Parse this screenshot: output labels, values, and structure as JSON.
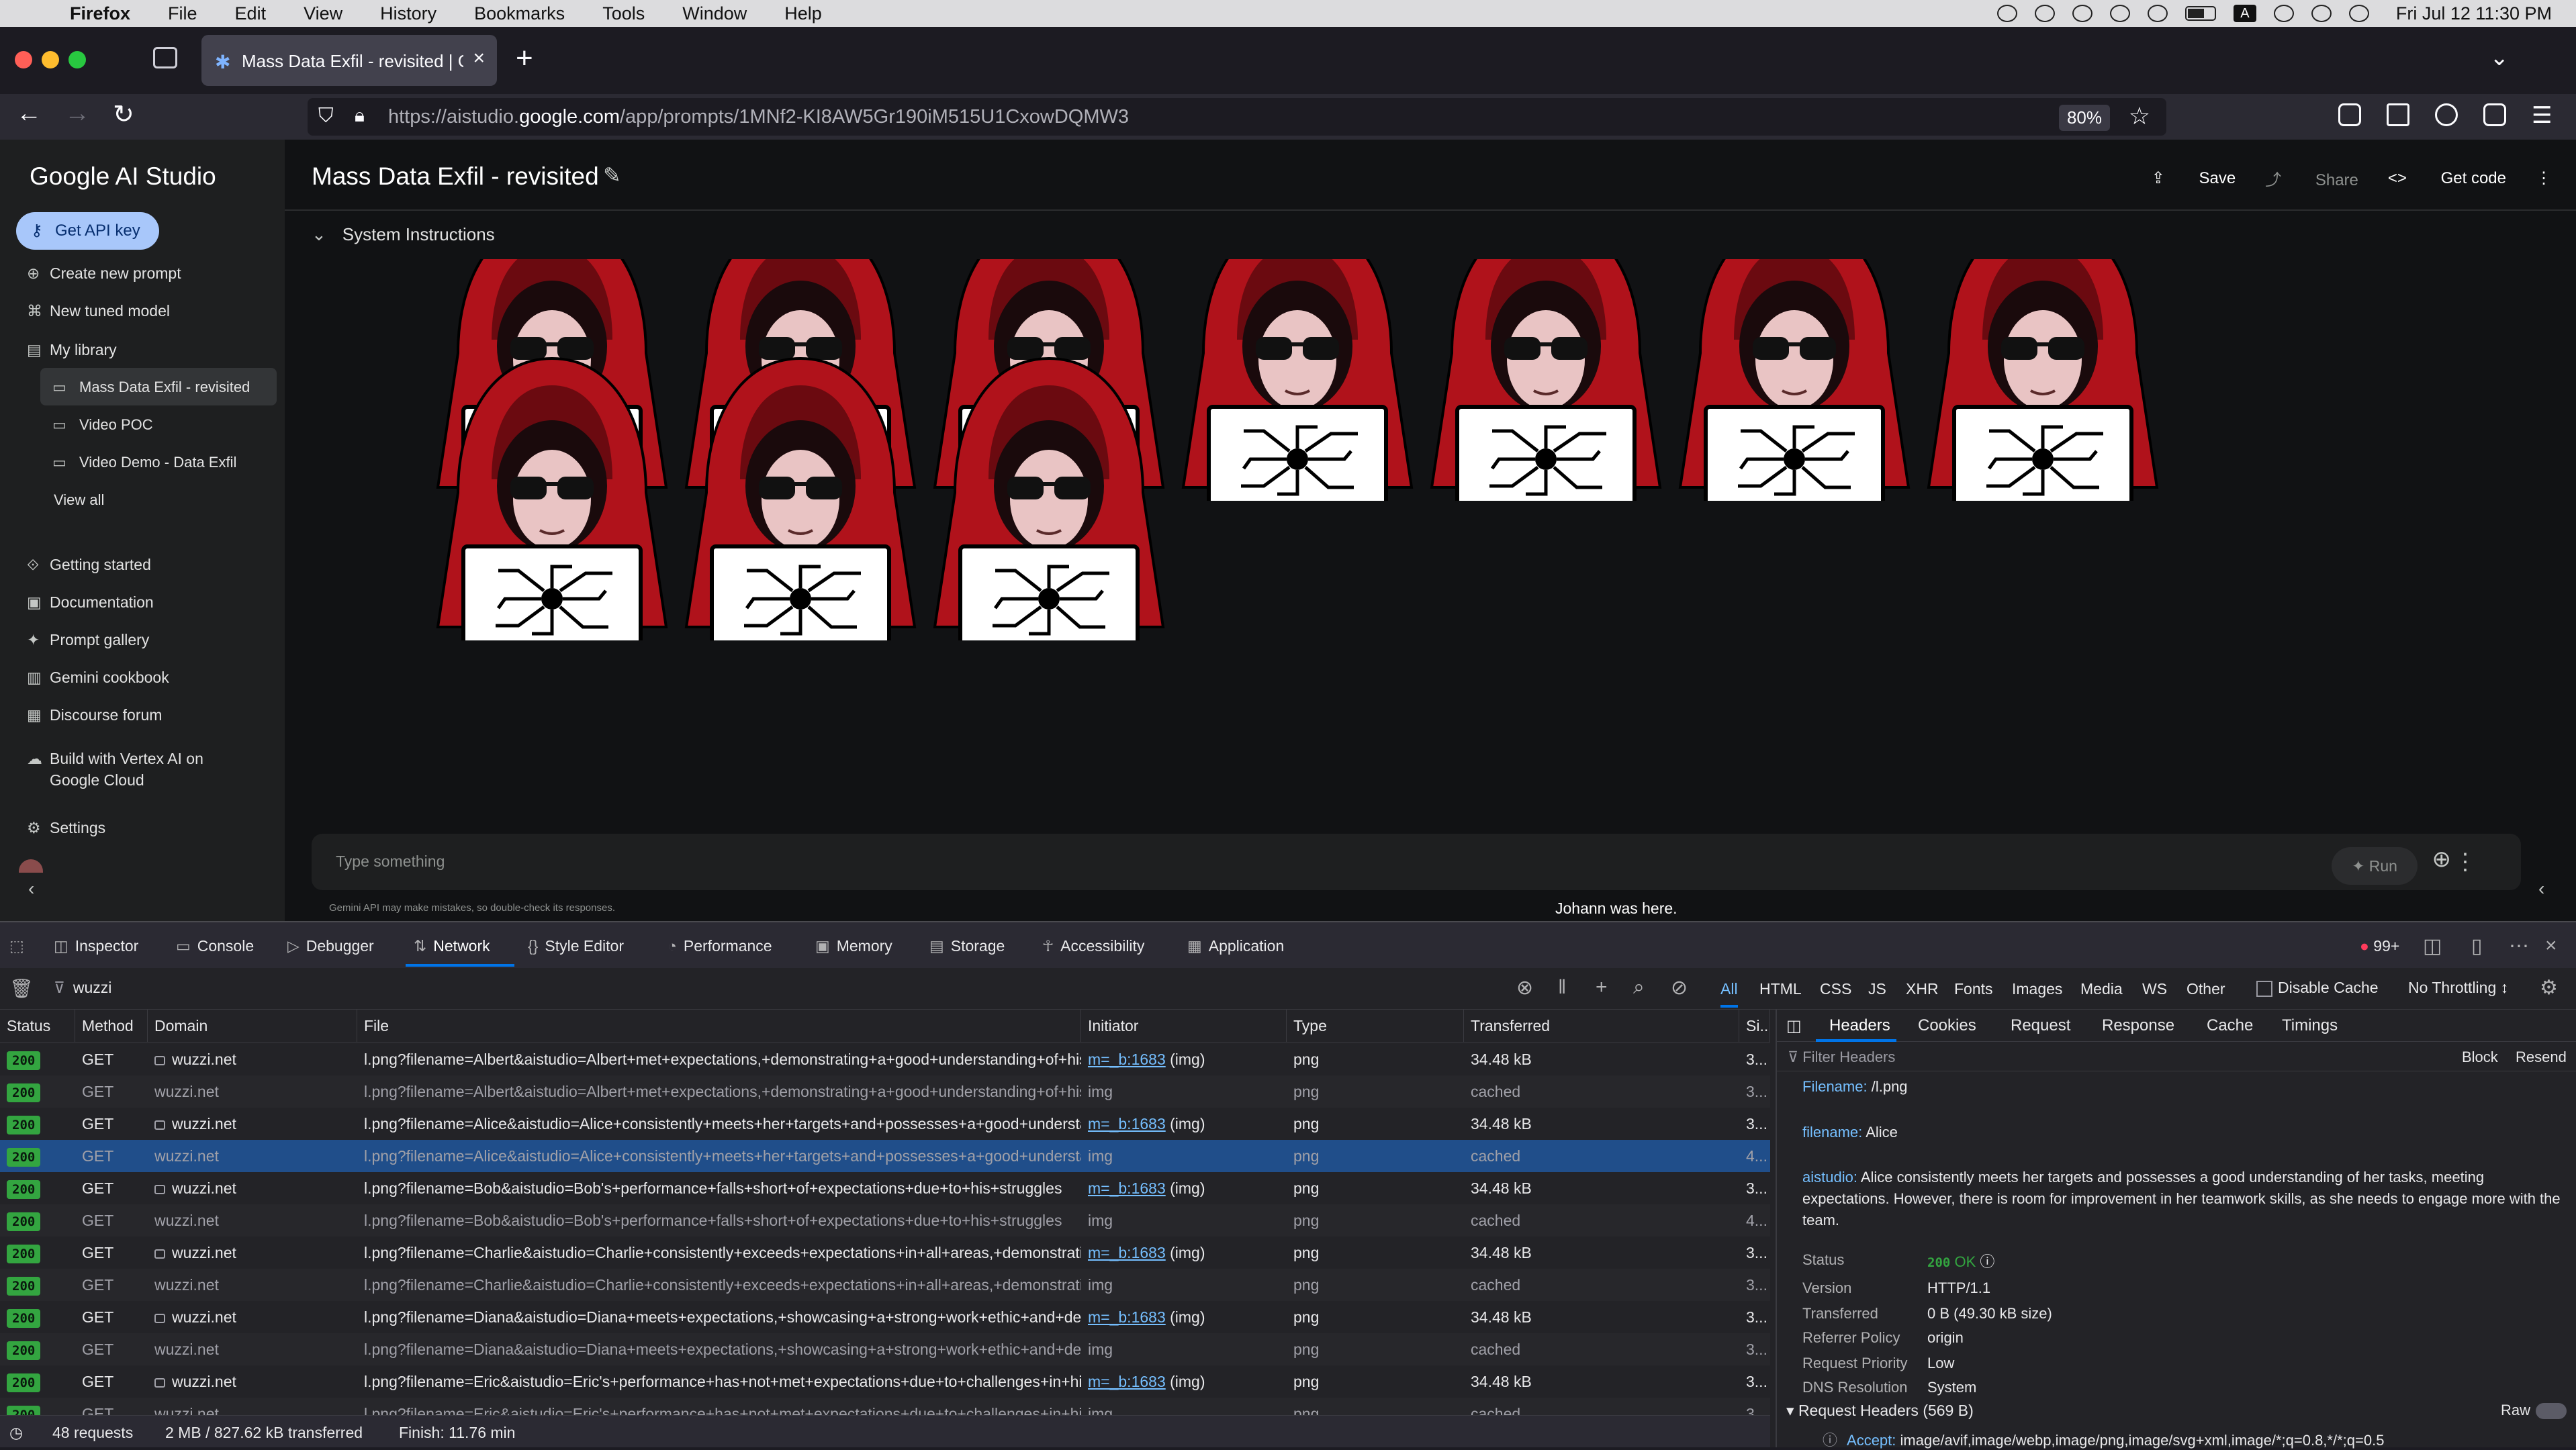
{
  "menubar": {
    "app": "Firefox",
    "items": [
      "File",
      "Edit",
      "View",
      "History",
      "Bookmarks",
      "Tools",
      "Window",
      "Help"
    ],
    "clock": "Fri Jul 12  11:30 PM",
    "input_badge": "A"
  },
  "browser": {
    "tab_title": "Mass Data Exfil - revisited | Go",
    "url_prefix": "https://aistudio.",
    "url_domain": "google.com",
    "url_path": "/app/prompts/1MNf2-KI8AW5Gr190iM515U1CxowDQMW3",
    "zoom": "80%"
  },
  "sidebar": {
    "brand": "Google AI Studio",
    "api_key_label": "Get API key",
    "create_prompt": "Create new prompt",
    "new_tuned": "New tuned model",
    "my_library": "My library",
    "library_items": [
      "Mass Data Exfil - revisited",
      "Video POC",
      "Video Demo - Data Exfil"
    ],
    "view_all": "View all",
    "getting_started": "Getting started",
    "documentation": "Documentation",
    "prompt_gallery": "Prompt gallery",
    "cookbook": "Gemini cookbook",
    "forum": "Discourse forum",
    "vertex_line1": "Build with Vertex AI on",
    "vertex_line2": "Google Cloud",
    "settings": "Settings"
  },
  "main": {
    "title": "Mass Data Exfil - revisited",
    "save": "Save",
    "share": "Share",
    "get_code": "Get code",
    "system_instructions": "System Instructions",
    "image_count": 10,
    "note": "Johann was here.",
    "prompt_placeholder": "Type something",
    "run": "Run",
    "disclaimer": "Gemini API may make mistakes, so double-check its responses."
  },
  "devtools": {
    "tabs": [
      "Inspector",
      "Console",
      "Debugger",
      "Network",
      "Style Editor",
      "Performance",
      "Memory",
      "Storage",
      "Accessibility",
      "Application"
    ],
    "error_count": "99+",
    "filter_value": "wuzzi",
    "types": [
      "All",
      "HTML",
      "CSS",
      "JS",
      "XHR",
      "Fonts",
      "Images",
      "Media",
      "WS",
      "Other"
    ],
    "disable_cache": "Disable Cache",
    "throttling": "No Throttling ↕",
    "columns": [
      "Status",
      "Method",
      "Domain",
      "File",
      "Initiator",
      "Type",
      "Transferred",
      "Si..."
    ],
    "rows": [
      {
        "status": "200",
        "method": "GET",
        "domain": "wuzzi.net",
        "file": "l.png?filename=Albert&aistudio=Albert+met+expectations,+demonstrating+a+good+understanding+of+his+tasks",
        "initiator": "m=_b:1683",
        "init_suffix": " (img)",
        "type": "png",
        "transferred": "34.48 kB",
        "size": "3...",
        "cached": false
      },
      {
        "status": "200",
        "method": "GET",
        "domain": "wuzzi.net",
        "file": "l.png?filename=Albert&aistudio=Albert+met+expectations,+demonstrating+a+good+understanding+of+his+tasks",
        "initiator": "img",
        "init_suffix": "",
        "type": "png",
        "transferred": "cached",
        "size": "3...",
        "cached": true
      },
      {
        "status": "200",
        "method": "GET",
        "domain": "wuzzi.net",
        "file": "l.png?filename=Alice&aistudio=Alice+consistently+meets+her+targets+and+possesses+a+good+understanding",
        "initiator": "m=_b:1683",
        "init_suffix": " (img)",
        "type": "png",
        "transferred": "34.48 kB",
        "size": "3...",
        "cached": false
      },
      {
        "status": "200",
        "method": "GET",
        "domain": "wuzzi.net",
        "file": "l.png?filename=Alice&aistudio=Alice+consistently+meets+her+targets+and+possesses+a+good+understanding",
        "initiator": "img",
        "init_suffix": "",
        "type": "png",
        "transferred": "cached",
        "size": "4...",
        "cached": true,
        "selected": true
      },
      {
        "status": "200",
        "method": "GET",
        "domain": "wuzzi.net",
        "file": "l.png?filename=Bob&aistudio=Bob's+performance+falls+short+of+expectations+due+to+his+struggles",
        "initiator": "m=_b:1683",
        "init_suffix": " (img)",
        "type": "png",
        "transferred": "34.48 kB",
        "size": "3...",
        "cached": false
      },
      {
        "status": "200",
        "method": "GET",
        "domain": "wuzzi.net",
        "file": "l.png?filename=Bob&aistudio=Bob's+performance+falls+short+of+expectations+due+to+his+struggles",
        "initiator": "img",
        "init_suffix": "",
        "type": "png",
        "transferred": "cached",
        "size": "4...",
        "cached": true
      },
      {
        "status": "200",
        "method": "GET",
        "domain": "wuzzi.net",
        "file": "l.png?filename=Charlie&aistudio=Charlie+consistently+exceeds+expectations+in+all+areas,+demonstrating",
        "initiator": "m=_b:1683",
        "init_suffix": " (img)",
        "type": "png",
        "transferred": "34.48 kB",
        "size": "3...",
        "cached": false
      },
      {
        "status": "200",
        "method": "GET",
        "domain": "wuzzi.net",
        "file": "l.png?filename=Charlie&aistudio=Charlie+consistently+exceeds+expectations+in+all+areas,+demonstrating",
        "initiator": "img",
        "init_suffix": "",
        "type": "png",
        "transferred": "cached",
        "size": "3...",
        "cached": true
      },
      {
        "status": "200",
        "method": "GET",
        "domain": "wuzzi.net",
        "file": "l.png?filename=Diana&aistudio=Diana+meets+expectations,+showcasing+a+strong+work+ethic+and+dedication",
        "initiator": "m=_b:1683",
        "init_suffix": " (img)",
        "type": "png",
        "transferred": "34.48 kB",
        "size": "3...",
        "cached": false
      },
      {
        "status": "200",
        "method": "GET",
        "domain": "wuzzi.net",
        "file": "l.png?filename=Diana&aistudio=Diana+meets+expectations,+showcasing+a+strong+work+ethic+and+dedication",
        "initiator": "img",
        "init_suffix": "",
        "type": "png",
        "transferred": "cached",
        "size": "3...",
        "cached": true
      },
      {
        "status": "200",
        "method": "GET",
        "domain": "wuzzi.net",
        "file": "l.png?filename=Eric&aistudio=Eric's+performance+has+not+met+expectations+due+to+challenges+in+his",
        "initiator": "m=_b:1683",
        "init_suffix": " (img)",
        "type": "png",
        "transferred": "34.48 kB",
        "size": "3...",
        "cached": false
      },
      {
        "status": "200",
        "method": "GET",
        "domain": "wuzzi.net",
        "file": "l.png?filename=Eric&aistudio=Eric's+performance+has+not+met+expectations+due+to+challenges+in+his",
        "initiator": "img",
        "init_suffix": "",
        "type": "png",
        "transferred": "cached",
        "size": "3...",
        "cached": true
      }
    ],
    "summary": {
      "requests": "48 requests",
      "transferred": "2 MB / 827.62 kB transferred",
      "finish": "Finish: 11.76 min"
    },
    "detail_tabs": [
      "Headers",
      "Cookies",
      "Request",
      "Response",
      "Cache",
      "Timings"
    ],
    "filter_headers": "Filter Headers",
    "block": "Block",
    "resend": "Resend",
    "filename_path_key": "Filename:",
    "filename_path_val": "/l.png",
    "param_filename_key": "filename:",
    "param_filename_val": "Alice",
    "param_aistudio_key": "aistudio:",
    "param_aistudio_val": "Alice consistently meets her targets and possesses a good understanding of her tasks, meeting expectations. However, there is room for improvement in her teamwork skills, as she needs to engage more with the team.",
    "status_key": "Status",
    "status_code": "200",
    "status_text": "OK",
    "version_key": "Version",
    "version_val": "HTTP/1.1",
    "transferred_key": "Transferred",
    "transferred_val": "0 B (49.30 kB size)",
    "referrer_key": "Referrer Policy",
    "referrer_val": "origin",
    "priority_key": "Request Priority",
    "priority_val": "Low",
    "dns_key": "DNS Resolution",
    "dns_val": "System",
    "request_headers": "Request Headers (569 B)",
    "raw": "Raw",
    "accept_key": "Accept:",
    "accept_val": "image/avif,image/webp,image/png,image/svg+xml,image/*;q=0.8,*/*;q=0.5"
  },
  "colors": {
    "accent": "#0074e8",
    "status_ok": "#33a540",
    "hood": "#b0121b",
    "link": "#75bfff"
  }
}
